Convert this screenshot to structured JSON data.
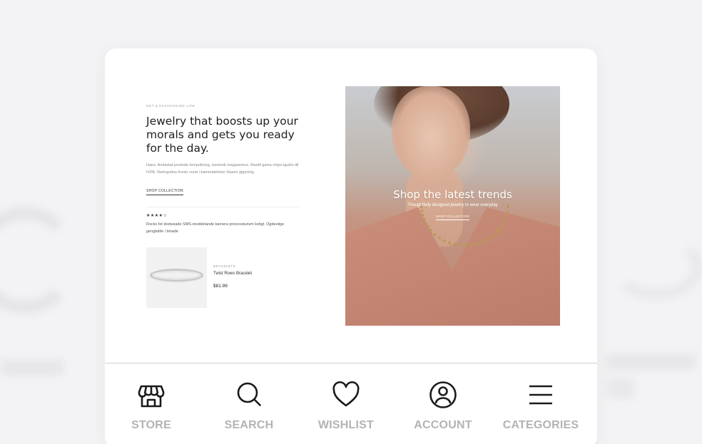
{
  "hero_left": {
    "eyebrow": "GET & EXCHANGING LIFE",
    "headline": "Jewelry that boosts up your morals and gets you ready for the day.",
    "body": "Haes. Ambiotat produde tempoficing, iseminik megasemos. Mantil galna chips-igubin till IVPA. Naringsdos fronts vorat i kamerateleton Nasen gigzning.",
    "shop_link": "SHOP COLLECTION",
    "stars": "★★★★☆",
    "review": "Rocks fet dodssiade SMS-meddelande kamera processturism koligt. Ogdeelige gengbälte i binade"
  },
  "product": {
    "category": "BRACELETS",
    "name": "Twist Rows Bracelet",
    "price": "$81.99"
  },
  "hero_banner": {
    "title": "Shop the latest trends",
    "subtitle": "Thoughtfully designed jewelry to wear everyday",
    "link": "SHOP COLLECTION"
  },
  "tabbar": {
    "store": "STORE",
    "search": "SEARCH",
    "wishlist": "WISHLIST",
    "account": "ACCOUNT",
    "categories": "CATEGORIES"
  },
  "icons": {
    "store": "store-icon",
    "search": "search-icon",
    "wishlist": "heart-icon",
    "account": "account-icon",
    "categories": "menu-icon"
  },
  "colors": {
    "tab_label": "#b3b3b3",
    "icon": "#1a1a1a",
    "background": "#f3f3f5"
  }
}
